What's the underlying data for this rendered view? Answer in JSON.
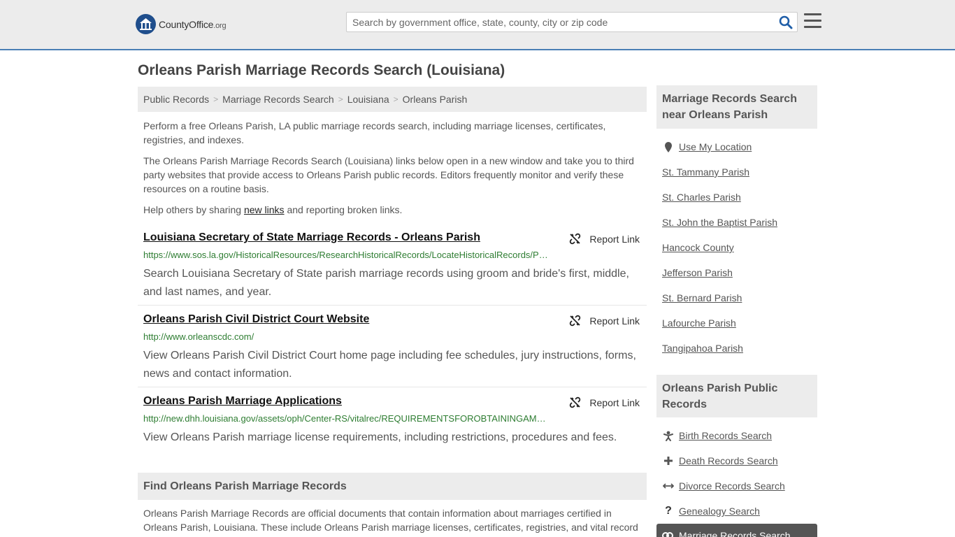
{
  "header": {
    "logo_name": "CountyOffice",
    "logo_tld": ".org",
    "search_placeholder": "Search by government office, state, county, city or zip code"
  },
  "page_title": "Orleans Parish Marriage Records Search (Louisiana)",
  "breadcrumb": [
    "Public Records",
    "Marriage Records Search",
    "Louisiana",
    "Orleans Parish"
  ],
  "intro": {
    "p1": "Perform a free Orleans Parish, LA public marriage records search, including marriage licenses, certificates, registries, and indexes.",
    "p2": "The Orleans Parish Marriage Records Search (Louisiana) links below open in a new window and take you to third party websites that provide access to Orleans Parish public records. Editors frequently monitor and verify these resources on a routine basis.",
    "p3_before": "Help others by sharing ",
    "p3_link": "new links",
    "p3_after": " and reporting broken links."
  },
  "report_label": "Report Link",
  "results": [
    {
      "title": "Louisiana Secretary of State Marriage Records - Orleans Parish",
      "url": "https://www.sos.la.gov/HistoricalResources/ResearchHistoricalRecords/LocateHistoricalRecords/Pages/ParishRecords.aspx",
      "desc": "Search Louisiana Secretary of State parish marriage records using groom and bride's first, middle, and last names, and year."
    },
    {
      "title": "Orleans Parish Civil District Court Website",
      "url": "http://www.orleanscdc.com/",
      "desc": "View Orleans Parish Civil District Court home page including fee schedules, jury instructions, forms, news and contact information."
    },
    {
      "title": "Orleans Parish Marriage Applications",
      "url": "http://new.dhh.louisiana.gov/assets/oph/Center-RS/vitalrec/REQUIREMENTSFOROBTAININGAMARRIAGELICENSE.pdf",
      "desc": "View Orleans Parish marriage license requirements, including restrictions, procedures and fees."
    }
  ],
  "find": {
    "heading": "Find Orleans Parish Marriage Records",
    "text": "Orleans Parish Marriage Records are official documents that contain information about marriages certified in Orleans Parish, Louisiana. These include Orleans Parish marriage licenses, certificates, registries, and vital record"
  },
  "sidebar": {
    "near_heading": "Marriage Records Search near Orleans Parish",
    "use_location": "Use My Location",
    "near_links": [
      "St. Tammany Parish",
      "St. Charles Parish",
      "St. John the Baptist Parish",
      "Hancock County",
      "Jefferson Parish",
      "St. Bernard Parish",
      "Lafourche Parish",
      "Tangipahoa Parish"
    ],
    "public_heading": "Orleans Parish Public Records",
    "public_links": [
      {
        "label": "Birth Records Search",
        "icon": "baby-icon"
      },
      {
        "label": "Death Records Search",
        "icon": "cross-icon"
      },
      {
        "label": "Divorce Records Search",
        "icon": "split-arrows-icon"
      },
      {
        "label": "Genealogy Search",
        "icon": "question-icon"
      }
    ],
    "active_link": "Marriage Records Search"
  }
}
